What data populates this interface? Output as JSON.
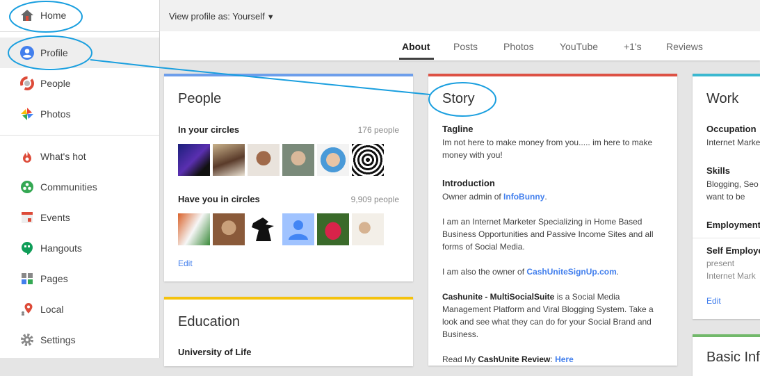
{
  "sidebar": {
    "items": [
      {
        "label": "Home",
        "icon": "home-icon"
      },
      {
        "label": "Profile",
        "icon": "profile-icon"
      },
      {
        "label": "People",
        "icon": "people-icon"
      },
      {
        "label": "Photos",
        "icon": "photos-icon"
      },
      {
        "label": "What's hot",
        "icon": "whats-hot-icon"
      },
      {
        "label": "Communities",
        "icon": "communities-icon"
      },
      {
        "label": "Events",
        "icon": "events-icon"
      },
      {
        "label": "Hangouts",
        "icon": "hangouts-icon"
      },
      {
        "label": "Pages",
        "icon": "pages-icon"
      },
      {
        "label": "Local",
        "icon": "local-icon"
      },
      {
        "label": "Settings",
        "icon": "settings-icon"
      }
    ]
  },
  "topbar": {
    "view_as": "View profile as: Yourself"
  },
  "tabs": [
    "About",
    "Posts",
    "Photos",
    "YouTube",
    "+1's",
    "Reviews"
  ],
  "people_card": {
    "title": "People",
    "in_circles_label": "In your circles",
    "in_circles_count": "176 people",
    "have_you_label": "Have you in circles",
    "have_you_count": "9,909 people",
    "edit": "Edit"
  },
  "education_card": {
    "title": "Education",
    "school": "University of Life"
  },
  "story_card": {
    "title": "Story",
    "tagline_label": "Tagline",
    "tagline_text": "Im not here to make money from you..... im here to make money with you!",
    "intro_label": "Introduction",
    "intro_prefix": "Owner admin of ",
    "intro_link": "InfoBunny",
    "intro_suffix": ".",
    "para1": "I am an Internet Marketer Specializing in Home Based Business Opportunities and Passive Income Sites and all forms of Social Media.",
    "para2_prefix": "I am also the owner of ",
    "para2_link": "CashUniteSignUp.com",
    "para2_suffix": ".",
    "para3_bold": "Cashunite - MultiSocialSuite",
    "para3_text": " is a Social Media Management Platform and Viral Blogging System. Take a look and see what they can do for your Social Brand and Business.",
    "para4_prefix": "Read My ",
    "para4_bold": "CashUnite Review",
    "para4_suffix": ": ",
    "para4_link": "Here"
  },
  "work_card": {
    "title": "Work",
    "occupation_label": "Occupation",
    "occupation_value": "Internet Marke",
    "skills_label": "Skills",
    "skills_line1": "Blogging, Seo",
    "skills_line2": "want to be",
    "employment_label": "Employment",
    "employer": "Self Employe",
    "present": "present",
    "employer_role": "Internet Mark",
    "edit": "Edit"
  },
  "basic_info_card": {
    "title": "Basic Inf"
  },
  "colors": {
    "people_bar": "#6d9eeb",
    "story_bar": "#dd5144",
    "work_bar": "#3bb8d0",
    "education_bar": "#f4c20d",
    "basic_bar": "#71b86a",
    "annotation": "#1a9fdf",
    "link": "#427fed"
  }
}
